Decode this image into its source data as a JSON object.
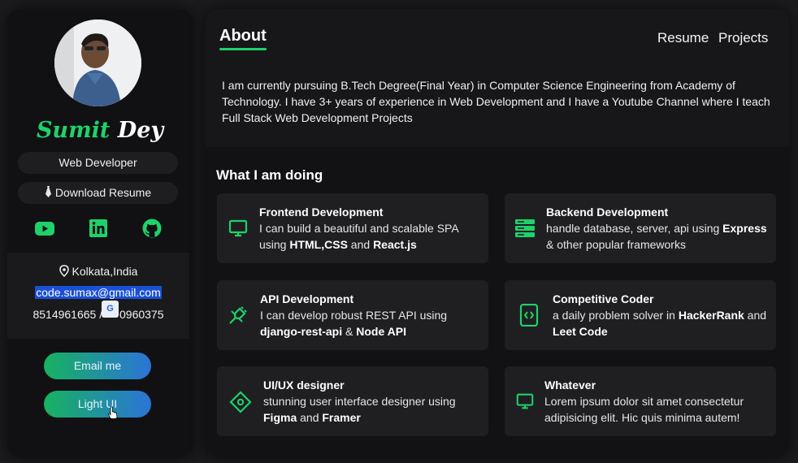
{
  "profile": {
    "first_name": "Sumit",
    "last_name": "Dey",
    "role": "Web Developer",
    "download": "Download Resume",
    "location": "Kolkata,India",
    "email": "code.sumax@gmail.com",
    "phone_a": "8514961665 / ",
    "phone_b": "0960375",
    "translate_badge": "G"
  },
  "social_icons": [
    "youtube-icon",
    "linkedin-icon",
    "github-icon"
  ],
  "buttons": {
    "email": "Email me",
    "theme": "Light UI"
  },
  "nav": {
    "about": "About",
    "resume": "Resume",
    "projects": "Projects"
  },
  "about_text": "I am currently pursuing B.Tech Degree(Final Year) in Computer Science Engineering from Academy of Technology. I have 3+ years of experience in Web Development and I have a Youtube Channel where I teach Full Stack Web Development Projects",
  "doing": {
    "title": "What I am doing",
    "cards": [
      {
        "title": "Frontend Development",
        "icon": "monitor-icon",
        "l1": "I can build a beautiful and scalable SPA",
        "l2a": "using ",
        "b1": "HTML,CSS",
        "l2b": " and ",
        "b2": "React.js"
      },
      {
        "title": "Backend Development",
        "icon": "server-icon",
        "l1a": "handle database, server, api using ",
        "b1": "Express",
        "l2": "& other popular frameworks"
      },
      {
        "title": "API Development",
        "icon": "plug-icon",
        "l1": "I can develop robust REST API using",
        "b1": "django-rest-api",
        "l2b": " & ",
        "b2": "Node API"
      },
      {
        "title": "Competitive Coder",
        "icon": "code-device-icon",
        "l1a": "a daily problem solver in ",
        "b1": "HackerRank",
        "l1b": " and",
        "b2": "Leet Code"
      },
      {
        "title": "UI/UX designer",
        "icon": "design-icon",
        "l1": "stunning user interface designer using",
        "b1": "Figma",
        "l2b": " and ",
        "b2": "Framer"
      },
      {
        "title": "Whatever",
        "icon": "monitor-icon",
        "l1": "Lorem ipsum dolor sit amet consectetur",
        "l2": "adipisicing elit. Hic quis minima autem!"
      }
    ]
  },
  "colors": {
    "accent": "#1ed26b",
    "gradient_start": "#17b25f",
    "gradient_end": "#2b74d8"
  }
}
